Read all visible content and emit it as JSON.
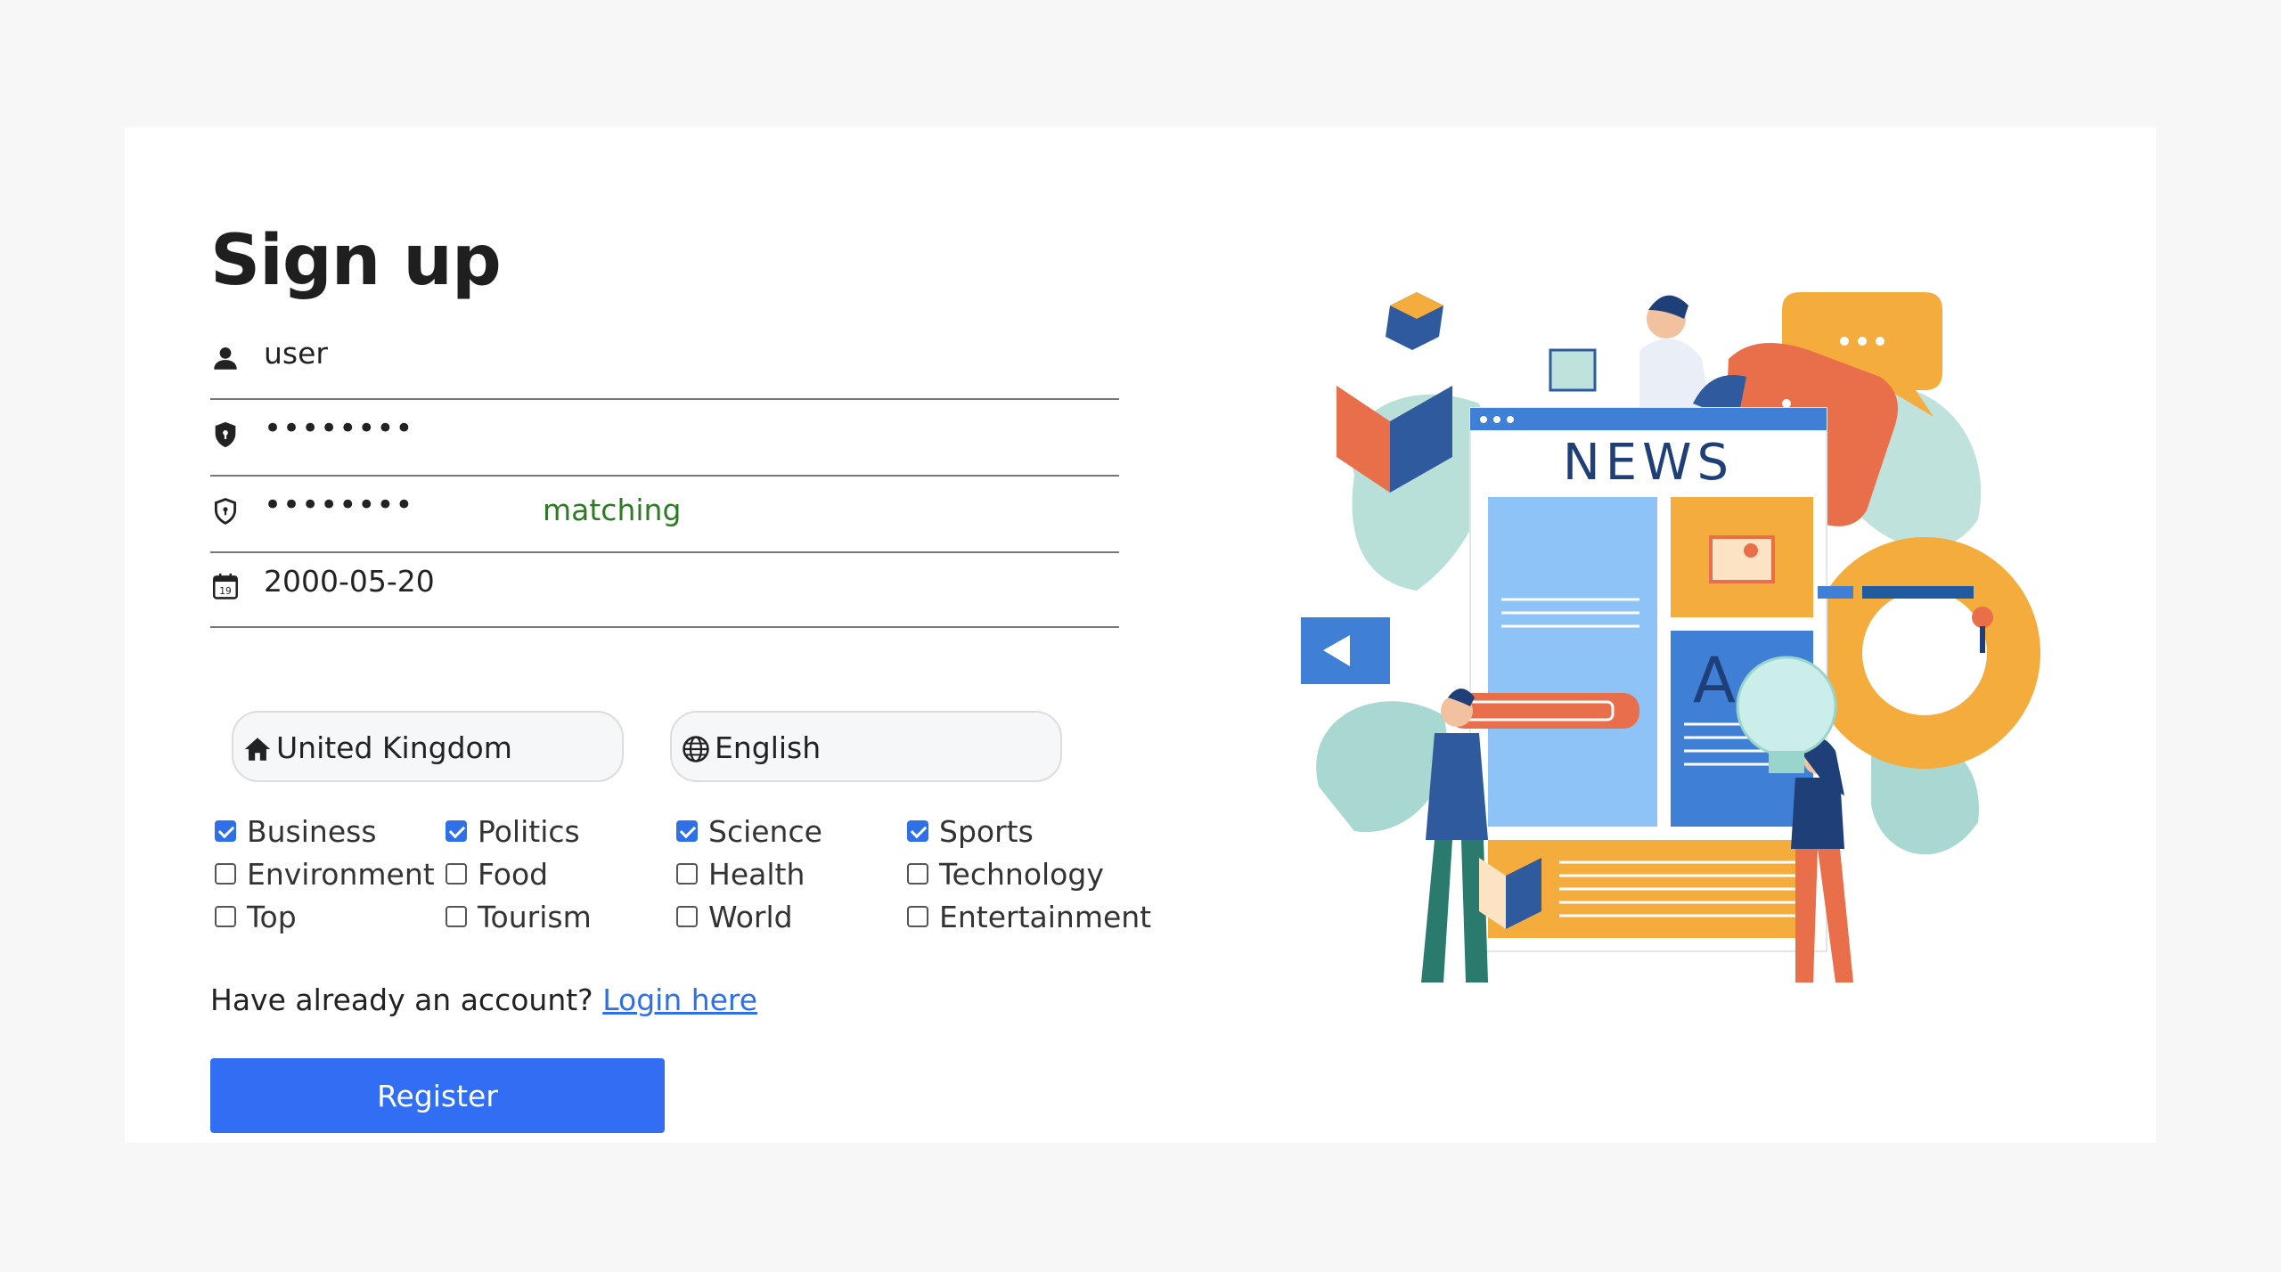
{
  "form": {
    "title": "Sign up",
    "username": "user",
    "password_mask": "••••••••",
    "confirm_mask": "••••••••",
    "confirm_status": "matching",
    "birthdate": "2000-05-20",
    "calendar_day": "19",
    "country": "United Kingdom",
    "language": "English"
  },
  "categories": [
    {
      "label": "Business",
      "checked": true
    },
    {
      "label": "Politics",
      "checked": true
    },
    {
      "label": "Science",
      "checked": true
    },
    {
      "label": "Sports",
      "checked": true
    },
    {
      "label": "Environment",
      "checked": false
    },
    {
      "label": "Food",
      "checked": false
    },
    {
      "label": "Health",
      "checked": false
    },
    {
      "label": "Technology",
      "checked": false
    },
    {
      "label": "Top",
      "checked": false
    },
    {
      "label": "Tourism",
      "checked": false
    },
    {
      "label": "World",
      "checked": false
    },
    {
      "label": "Entertainment",
      "checked": false
    }
  ],
  "footer": {
    "login_prompt": "Have already an account?",
    "login_link": "Login here",
    "register_label": "Register"
  },
  "illustration": {
    "headline": "NEWS",
    "letter": "A"
  },
  "colors": {
    "accent": "#316ef4",
    "match": "#2f7a25"
  }
}
